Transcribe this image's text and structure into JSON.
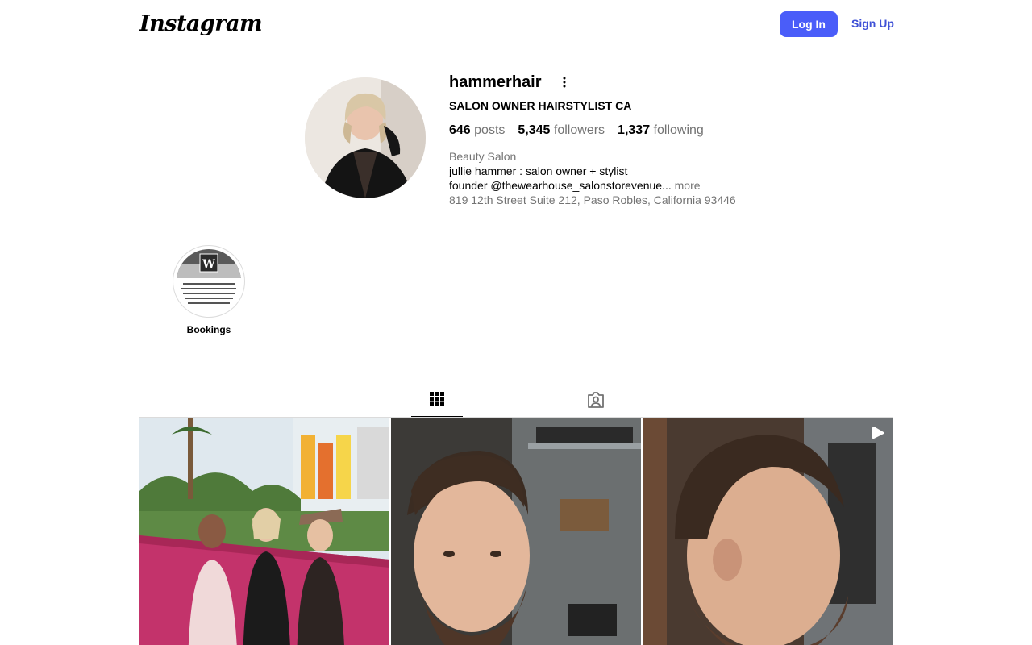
{
  "header": {
    "logo": "Instagram",
    "login_label": "Log In",
    "signup_label": "Sign Up",
    "accent_color": "#4a5df9"
  },
  "profile": {
    "username": "hammerhair",
    "full_name": "SALON OWNER HAIRSTYLIST CA",
    "stats": [
      {
        "value": "646",
        "label": "posts"
      },
      {
        "value": "5,345",
        "label": "followers"
      },
      {
        "value": "1,337",
        "label": "following"
      }
    ],
    "category": "Beauty Salon",
    "bio_line1": "jullie hammer : salon owner + stylist",
    "bio_line2": "founder @thewearhouse_salonstorevenue...",
    "bio_more": "more",
    "address": "819 12th Street Suite 212, Paso Robles, California 93446"
  },
  "highlights": [
    {
      "label": "Bookings",
      "icon": "W"
    }
  ],
  "tabs": [
    {
      "name": "posts",
      "icon": "grid-icon",
      "active": true
    },
    {
      "name": "tagged",
      "icon": "tagged-user-icon",
      "active": false
    }
  ],
  "posts": [
    {
      "subject": "three-women-photo",
      "type": "image"
    },
    {
      "subject": "man-haircut-front",
      "type": "image"
    },
    {
      "subject": "man-haircut-profile",
      "type": "reel"
    }
  ]
}
